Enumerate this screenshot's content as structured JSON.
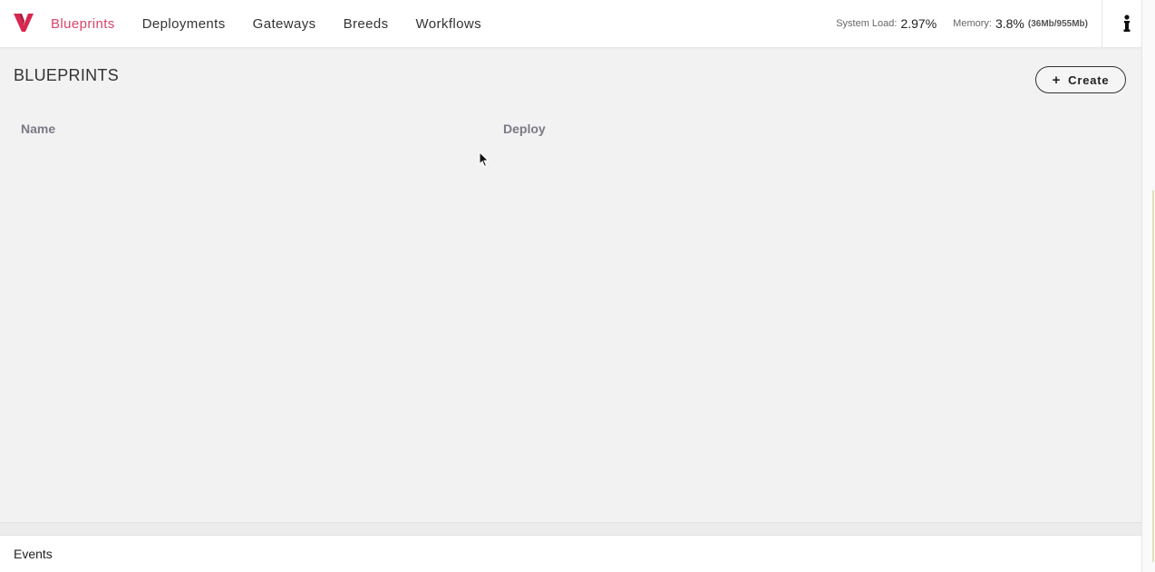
{
  "nav": {
    "items": [
      {
        "label": "Blueprints",
        "active": true
      },
      {
        "label": "Deployments",
        "active": false
      },
      {
        "label": "Gateways",
        "active": false
      },
      {
        "label": "Breeds",
        "active": false
      },
      {
        "label": "Workflows",
        "active": false
      }
    ],
    "accent_color": "#d9456a"
  },
  "stats": {
    "system_load_label": "System Load:",
    "system_load_value": "2.97%",
    "memory_label": "Memory:",
    "memory_value": "3.8%",
    "memory_detail": "(36Mb/955Mb)"
  },
  "icons": {
    "logo": "vamp-logo-icon",
    "info": "info-icon",
    "create": "plus-icon"
  },
  "main": {
    "title": "BLUEPRINTS",
    "create_label": "Create",
    "columns": [
      "Name",
      "Deploy"
    ]
  },
  "footer": {
    "events_label": "Events"
  }
}
